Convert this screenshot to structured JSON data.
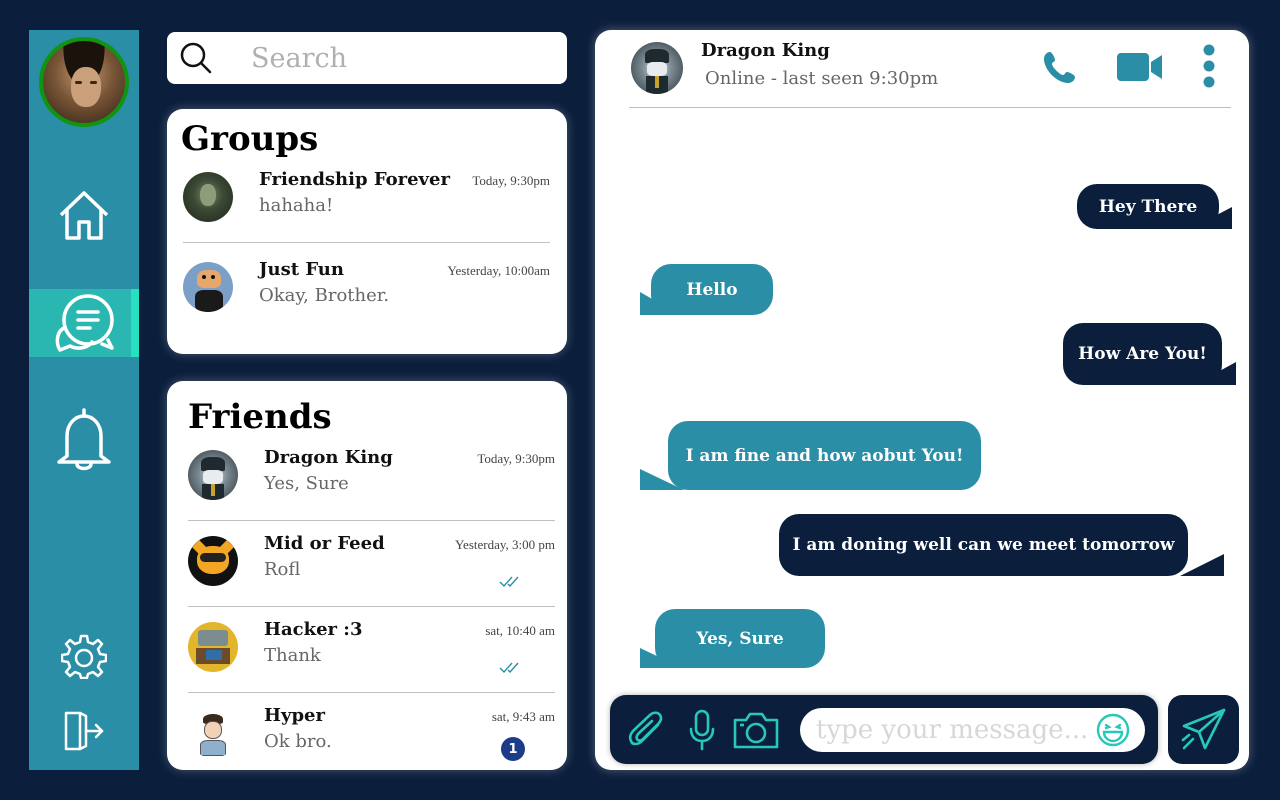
{
  "search": {
    "placeholder": "Search"
  },
  "groups": {
    "title": "Groups",
    "items": [
      {
        "name": "Friendship Forever",
        "message": "hahaha!",
        "time": "Today, 9:30pm"
      },
      {
        "name": "Just Fun",
        "message": "Okay, Brother.",
        "time": "Yesterday, 10:00am"
      }
    ]
  },
  "friends": {
    "title": "Friends",
    "items": [
      {
        "name": "Dragon King",
        "message": "Yes, Sure",
        "time": "Today, 9:30pm"
      },
      {
        "name": "Mid or Feed",
        "message": "Rofl",
        "time": "Yesterday, 3:00 pm",
        "read": true
      },
      {
        "name": "Hacker :3",
        "message": "Thank",
        "time": "sat, 10:40 am",
        "read": true
      },
      {
        "name": "Hyper",
        "message": "Ok bro.",
        "time": "sat, 9:43 am",
        "unread_count": "1"
      }
    ]
  },
  "chat": {
    "contact_name": "Dragon King",
    "status": "Online - last seen 9:30pm",
    "messages": [
      {
        "text": "Hey There",
        "direction": "outgoing"
      },
      {
        "text": "Hello",
        "direction": "incoming"
      },
      {
        "text": "How Are You!",
        "direction": "outgoing"
      },
      {
        "text": "I am fine and how aobut You!",
        "direction": "incoming"
      },
      {
        "text": "I am doning well can we meet tomorrow",
        "direction": "outgoing"
      },
      {
        "text": "Yes, Sure",
        "direction": "incoming"
      }
    ]
  },
  "composer": {
    "placeholder": "type your message..."
  },
  "colors": {
    "navy": "#0b1f3d",
    "teal": "#2a8ea6",
    "accent": "#26e0c0",
    "online_ring": "#119411"
  },
  "icons": [
    "home-icon",
    "chat-icon",
    "bell-icon",
    "settings-icon",
    "logout-icon",
    "search-icon",
    "phone-icon",
    "video-icon",
    "more-vertical-icon",
    "paperclip-icon",
    "microphone-icon",
    "camera-icon",
    "emoji-icon",
    "send-icon"
  ]
}
